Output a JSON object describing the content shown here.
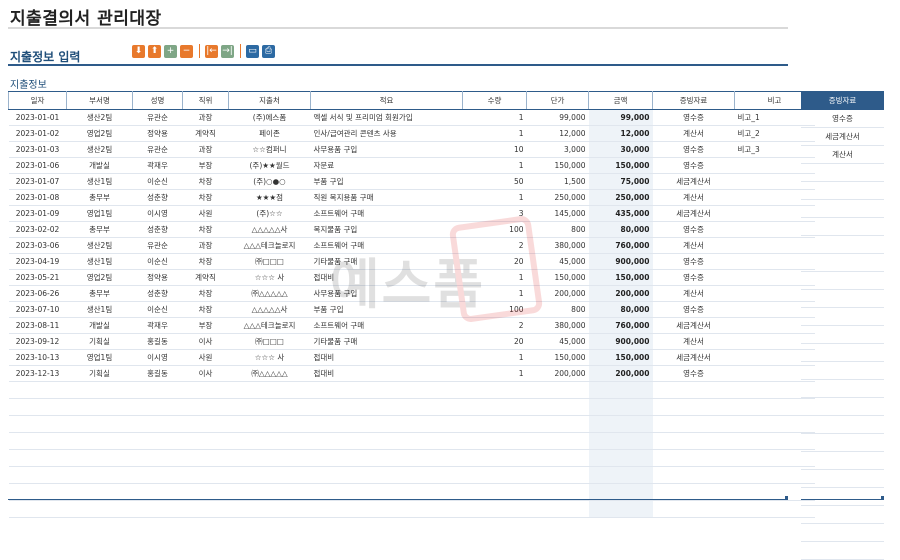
{
  "title": "지출결의서 관리대장",
  "section_title": "지출정보 입력",
  "sub_title": "지출정보",
  "toolbar": {
    "buttons": [
      {
        "name": "move-down-icon",
        "glyph": "⬇",
        "color": "#e8792c"
      },
      {
        "name": "move-up-icon",
        "glyph": "⬆",
        "color": "#e8792c"
      },
      {
        "name": "add-row-icon",
        "glyph": "+",
        "color": "#7fa686"
      },
      {
        "name": "delete-row-icon",
        "glyph": "−",
        "color": "#e8792c"
      },
      {
        "name": "first-icon",
        "glyph": "|←",
        "color": "#e8792c"
      },
      {
        "name": "last-icon",
        "glyph": "→|",
        "color": "#7fa686"
      },
      {
        "name": "preview-icon",
        "glyph": "▭",
        "color": "#2d6aa3"
      },
      {
        "name": "print-icon",
        "glyph": "⎙",
        "color": "#2d6aa3"
      }
    ]
  },
  "columns": [
    "일자",
    "부서명",
    "성명",
    "직위",
    "지출처",
    "적요",
    "수량",
    "단가",
    "금액",
    "증빙자료",
    "비고"
  ],
  "rows": [
    {
      "date": "2023-01-01",
      "dept": "생산2팀",
      "name": "유관순",
      "pos": "과장",
      "vendor": "(주)에스폼",
      "desc": "엑셀 서식 및 프리미엄 회원가입",
      "qty": "1",
      "price": "99,000",
      "amount": "99,000",
      "proof": "영수증",
      "note": "비고_1"
    },
    {
      "date": "2023-01-02",
      "dept": "영업2팀",
      "name": "정약용",
      "pos": "계약직",
      "vendor": "페이존",
      "desc": "인사/급여관리 콘텐츠 사용",
      "qty": "1",
      "price": "12,000",
      "amount": "12,000",
      "proof": "계산서",
      "note": "비고_2"
    },
    {
      "date": "2023-01-03",
      "dept": "생산2팀",
      "name": "유관순",
      "pos": "과장",
      "vendor": "☆☆컴퍼니",
      "desc": "사무용품 구입",
      "qty": "10",
      "price": "3,000",
      "amount": "30,000",
      "proof": "영수증",
      "note": "비고_3"
    },
    {
      "date": "2023-01-06",
      "dept": "개발실",
      "name": "곽재우",
      "pos": "부장",
      "vendor": "(주)★★월드",
      "desc": "자문료",
      "qty": "1",
      "price": "150,000",
      "amount": "150,000",
      "proof": "영수증",
      "note": ""
    },
    {
      "date": "2023-01-07",
      "dept": "생산1팀",
      "name": "이순신",
      "pos": "차장",
      "vendor": "(주)○●○",
      "desc": "부품 구입",
      "qty": "50",
      "price": "1,500",
      "amount": "75,000",
      "proof": "세금계산서",
      "note": ""
    },
    {
      "date": "2023-01-08",
      "dept": "총무부",
      "name": "성춘향",
      "pos": "차장",
      "vendor": "★★★점",
      "desc": "직원 복지용품 구매",
      "qty": "1",
      "price": "250,000",
      "amount": "250,000",
      "proof": "계산서",
      "note": ""
    },
    {
      "date": "2023-01-09",
      "dept": "영업1팀",
      "name": "이시영",
      "pos": "사원",
      "vendor": "(주)☆☆",
      "desc": "소프트웨어 구매",
      "qty": "3",
      "price": "145,000",
      "amount": "435,000",
      "proof": "세금계산서",
      "note": ""
    },
    {
      "date": "2023-02-02",
      "dept": "총무부",
      "name": "성춘향",
      "pos": "차장",
      "vendor": "△△△△△사",
      "desc": "복지물품 구입",
      "qty": "100",
      "price": "800",
      "amount": "80,000",
      "proof": "영수증",
      "note": ""
    },
    {
      "date": "2023-03-06",
      "dept": "생산2팀",
      "name": "유관순",
      "pos": "과장",
      "vendor": "△△△테크놀로지",
      "desc": "소프트웨어 구매",
      "qty": "2",
      "price": "380,000",
      "amount": "760,000",
      "proof": "계산서",
      "note": ""
    },
    {
      "date": "2023-04-19",
      "dept": "생산1팀",
      "name": "이순신",
      "pos": "차장",
      "vendor": "㈜□□□",
      "desc": "기타물품 구매",
      "qty": "20",
      "price": "45,000",
      "amount": "900,000",
      "proof": "영수증",
      "note": ""
    },
    {
      "date": "2023-05-21",
      "dept": "영업2팀",
      "name": "정약용",
      "pos": "계약직",
      "vendor": "☆☆☆ 사",
      "desc": "접대비",
      "qty": "1",
      "price": "150,000",
      "amount": "150,000",
      "proof": "영수증",
      "note": ""
    },
    {
      "date": "2023-06-26",
      "dept": "총무부",
      "name": "성춘향",
      "pos": "차장",
      "vendor": "㈜△△△△△",
      "desc": "사무용품 구입",
      "qty": "1",
      "price": "200,000",
      "amount": "200,000",
      "proof": "계산서",
      "note": ""
    },
    {
      "date": "2023-07-10",
      "dept": "생산1팀",
      "name": "이순신",
      "pos": "차장",
      "vendor": "△△△△△사",
      "desc": "부품 구입",
      "qty": "100",
      "price": "800",
      "amount": "80,000",
      "proof": "영수증",
      "note": ""
    },
    {
      "date": "2023-08-11",
      "dept": "개발실",
      "name": "곽재우",
      "pos": "부장",
      "vendor": "△△△테크놀로지",
      "desc": "소프트웨어 구매",
      "qty": "2",
      "price": "380,000",
      "amount": "760,000",
      "proof": "세금계산서",
      "note": ""
    },
    {
      "date": "2023-09-12",
      "dept": "기획실",
      "name": "홍길동",
      "pos": "이사",
      "vendor": "㈜□□□",
      "desc": "기타물품 구매",
      "qty": "20",
      "price": "45,000",
      "amount": "900,000",
      "proof": "계산서",
      "note": ""
    },
    {
      "date": "2023-10-13",
      "dept": "영업1팀",
      "name": "이시영",
      "pos": "사원",
      "vendor": "☆☆☆ 사",
      "desc": "접대비",
      "qty": "1",
      "price": "150,000",
      "amount": "150,000",
      "proof": "세금계산서",
      "note": ""
    },
    {
      "date": "2023-12-13",
      "dept": "기획실",
      "name": "홍길동",
      "pos": "이사",
      "vendor": "㈜△△△△△",
      "desc": "접대비",
      "qty": "1",
      "price": "200,000",
      "amount": "200,000",
      "proof": "영수증",
      "note": ""
    }
  ],
  "empty_rows": 8,
  "side_panel": {
    "header": "증빙자료",
    "items": [
      "영수증",
      "세금계산서",
      "계산서"
    ],
    "empty_rows": 22
  },
  "watermark": {
    "text": "예스폼"
  },
  "colors": {
    "accent": "#2e5b8a",
    "orange": "#e8792c",
    "green": "#7fa686",
    "amount_bg": "#eef3f8"
  }
}
